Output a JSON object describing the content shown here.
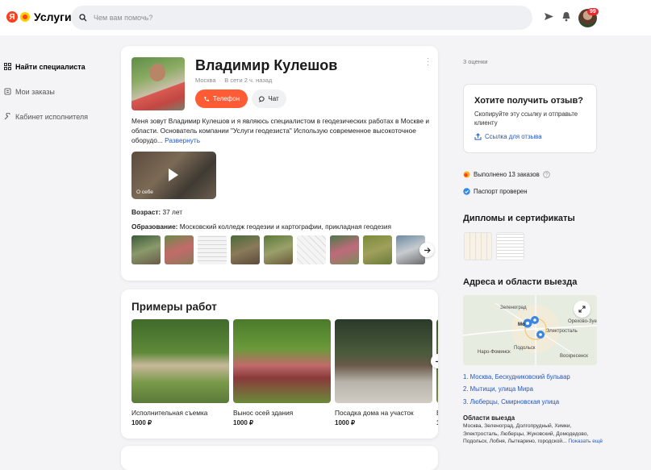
{
  "header": {
    "logo_text": "Услуги",
    "logo_letter": "Я",
    "search_placeholder": "Чем вам помочь?",
    "notif_count": "99"
  },
  "sidebar": {
    "items": [
      {
        "label": "Найти специалиста",
        "icon": "grid-icon"
      },
      {
        "label": "Мои заказы",
        "icon": "orders-icon"
      },
      {
        "label": "Кабинет исполнителя",
        "icon": "wrench-icon"
      }
    ]
  },
  "profile": {
    "name": "Владимир Кулешов",
    "city": "Москва",
    "separator": "·",
    "online": "В сети 2 ч. назад",
    "phone_label": "Телефон",
    "chat_label": "Чат",
    "bio": "Меня зовут Владимир Кулешов и я являюсь специалистом в геодезических работах в Москве и области. Основатель компании \"Услуги геодезиста\" Использую современное высокоточное оборудо...",
    "bio_more": "Развернуть",
    "video_label": "О себе",
    "age_label": "Возраст:",
    "age_value": "37 лет",
    "edu_label": "Образование:",
    "edu_value": "Московский колледж геодезии и картографии, прикладная геодезия"
  },
  "works": {
    "title": "Примеры работ",
    "items": [
      {
        "title": "Исполнительная съемка",
        "price": "1000 ₽"
      },
      {
        "title": "Вынос осей здания",
        "price": "1000 ₽"
      },
      {
        "title": "Посадка дома на участок",
        "price": "1000 ₽"
      },
      {
        "title": "В",
        "price": "1"
      }
    ]
  },
  "right": {
    "ratings": "3 оценки",
    "review_title": "Хотите получить отзыв?",
    "review_text": "Скопируйте эту ссылку и отправьте клиенту",
    "review_link": "Ссылка для отзыва",
    "orders_done": "Выполнено 13 заказов",
    "passport": "Паспорт проверен",
    "diplomas_title": "Дипломы и сертификаты",
    "addresses_title": "Адреса и области выезда",
    "addresses": [
      "1. Москва, Бескудниковский бульвар",
      "2. Мытищи, улица Мира",
      "3. Люберцы, Смирновская улица"
    ],
    "areas_title": "Области выезда",
    "areas_text": "Москва, Зеленоград, Долгопрудный, Химки, Электросталь, Люберцы, Жуковский, Домодедово, Подольск, Лобня, Лыткарино, городской...",
    "areas_more": "Показать ещё"
  },
  "map_labels": {
    "zelenograd": "Зеленоград",
    "moscow": "Мо",
    "elektrostal": "Электросталь",
    "orekhovo": "Орехово-Зуе",
    "naro": "Наро-Фоминск",
    "podolsk": "Подольск",
    "voskresensk": "Воскресенск"
  },
  "colors": {
    "accent": "#ff5c35",
    "link": "#2556b8",
    "badge": "#e9282f"
  }
}
